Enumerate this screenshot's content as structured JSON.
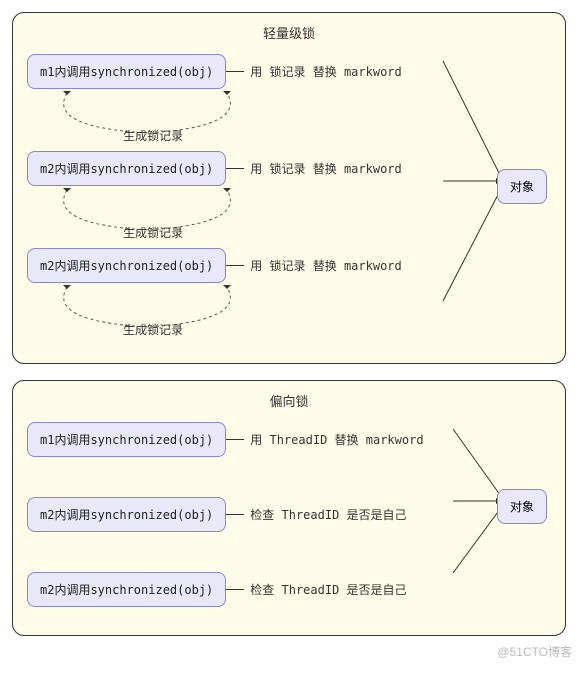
{
  "panel1": {
    "title": "轻量级锁",
    "rows": [
      {
        "node": "m1内调用synchronized(obj)",
        "edge": "用 锁记录 替换 markword",
        "loop": "生成锁记录"
      },
      {
        "node": "m2内调用synchronized(obj)",
        "edge": "用 锁记录 替换 markword",
        "loop": "生成锁记录"
      },
      {
        "node": "m2内调用synchronized(obj)",
        "edge": "用 锁记录 替换 markword",
        "loop": "生成锁记录"
      }
    ],
    "target": "对象"
  },
  "panel2": {
    "title": "偏向锁",
    "rows": [
      {
        "node": "m1内调用synchronized(obj)",
        "edge": "用 ThreadID 替换 markword"
      },
      {
        "node": "m2内调用synchronized(obj)",
        "edge": "检查 ThreadID 是否是自己"
      },
      {
        "node": "m2内调用synchronized(obj)",
        "edge": "检查 ThreadID 是否是自己"
      }
    ],
    "target": "对象"
  },
  "watermark": "@51CTO博客"
}
